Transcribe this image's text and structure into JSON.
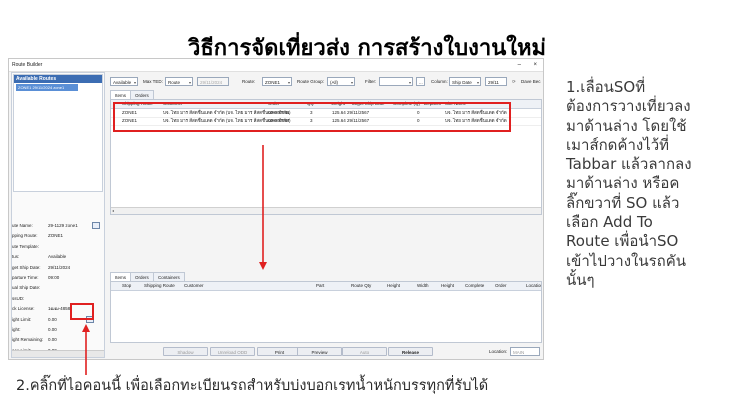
{
  "slide": {
    "title": "วิธีการจัดเที่ยวส่ง การสร้างใบงานใหม่",
    "instruction_right_lines": [
      "1.เลื่อนSOที่",
      "ต้องการวางเที่ยวลง",
      "มาด้านล่าง โดยใช้",
      "เมาส์กดค้างไว้ที่",
      "Tabbar แล้วลากลง",
      "มาด้านล่าง หรือค",
      "ลิ๊กขวาที่ SO แล้ว",
      "เลือก Add To",
      "Route เพื่อนำSO",
      "เข้าไปวางในรถคัน",
      "นั้นๆ"
    ],
    "instruction_bottom": "2.คลิ๊กที่ไอคอนนี้ เพื่อเลือกทะเบียนรถสำหรับบ่งบอกเรทน้ำหนักบรรทุกที่รับได้",
    "highlight_color": "#e02020"
  },
  "window": {
    "title": "Route Builder",
    "minimize_glyph": "–",
    "close_glyph": "×"
  },
  "left_panel": {
    "header": "Available Routes",
    "selected_item": "ZONE1 29/11/2024 zone1",
    "properties": [
      {
        "key": "ute Name:",
        "value": "29-1129 zone1"
      },
      {
        "key": "pping Route:",
        "value": "ZONE1"
      },
      {
        "key": "ute Template:",
        "value": ""
      },
      {
        "key": "tus:",
        "value": "Available"
      },
      {
        "key": "get Ship Date:",
        "value": "29/11/2024"
      },
      {
        "key": "parture Time:",
        "value": "09:00"
      },
      {
        "key": "ual Ship Date:",
        "value": ""
      },
      {
        "key": "ssUD:",
        "value": ""
      },
      {
        "key": "ck License:",
        "value": "1ฒฒ-4858"
      },
      {
        "key": "ight Limit:",
        "value": "0.00"
      },
      {
        "key": "ight:",
        "value": "0.00"
      },
      {
        "key": "ight Remaining:",
        "value": "0.00"
      },
      {
        "key": "ace Limit:",
        "value": "0.00"
      }
    ]
  },
  "toolbar": {
    "available": "Available",
    "max_ted_label": "Max TED:",
    "max_ted_value": "Route",
    "date_value": "29/11/2024",
    "route_label": "Route:",
    "route_value": "ZONE1",
    "route_group_label": "Route Group:",
    "route_group_value": "(All)",
    "filter_label": "Filter:",
    "filter_value": "",
    "ellipsis": "...",
    "column_label": "Column:",
    "column_value": "Ship Date",
    "column_date": "29/11",
    "dave_label": "Dave Bec"
  },
  "upper_tabs": [
    "Items",
    "Orders"
  ],
  "upper_grid": {
    "columns": [
      "Shipping Route",
      "Customer",
      "Order",
      "Qty",
      "Weight",
      "Target Ship Date",
      "Complete (Q)",
      "Departm",
      "Site Name"
    ],
    "rows": [
      [
        "ZONE1",
        "บจ. ไทย มาร สีสดชื่นแดด จำกัด (บจ. ไทย มาร สีสดชื่นแดด จำกัด)",
        "00-000941",
        "3",
        "125.64",
        "29/11/2567",
        "0",
        "",
        "บจ. ไทย มาร สีสดชื่นแดด จำกัด"
      ],
      [
        "ZONE1",
        "บจ. ไทย มาร สีสดชื่นแดด จำกัด (บจ. ไทย มาร สีสดชื่นแดด จำกัด)",
        "00-000987",
        "3",
        "125.64",
        "29/11/2567",
        "0",
        "",
        "บจ. ไทย มาร สีสดชื่นแดด จำกัด"
      ]
    ]
  },
  "lower_tabs": [
    "Items",
    "Orders",
    "Containers"
  ],
  "lower_grid": {
    "columns": [
      "Stop",
      "Shipping Route",
      "Customer",
      "Part",
      "Route Qty",
      "Height",
      "Width",
      "Height",
      "Complete",
      "Order",
      "Location"
    ]
  },
  "buttons": {
    "shadow": "Shadow",
    "unreload": "Unreload ODD",
    "print": "Print",
    "preview": "Preview",
    "auto": "Auto",
    "release": "Release",
    "location_label": "Location:",
    "location_value": "MAIN"
  }
}
